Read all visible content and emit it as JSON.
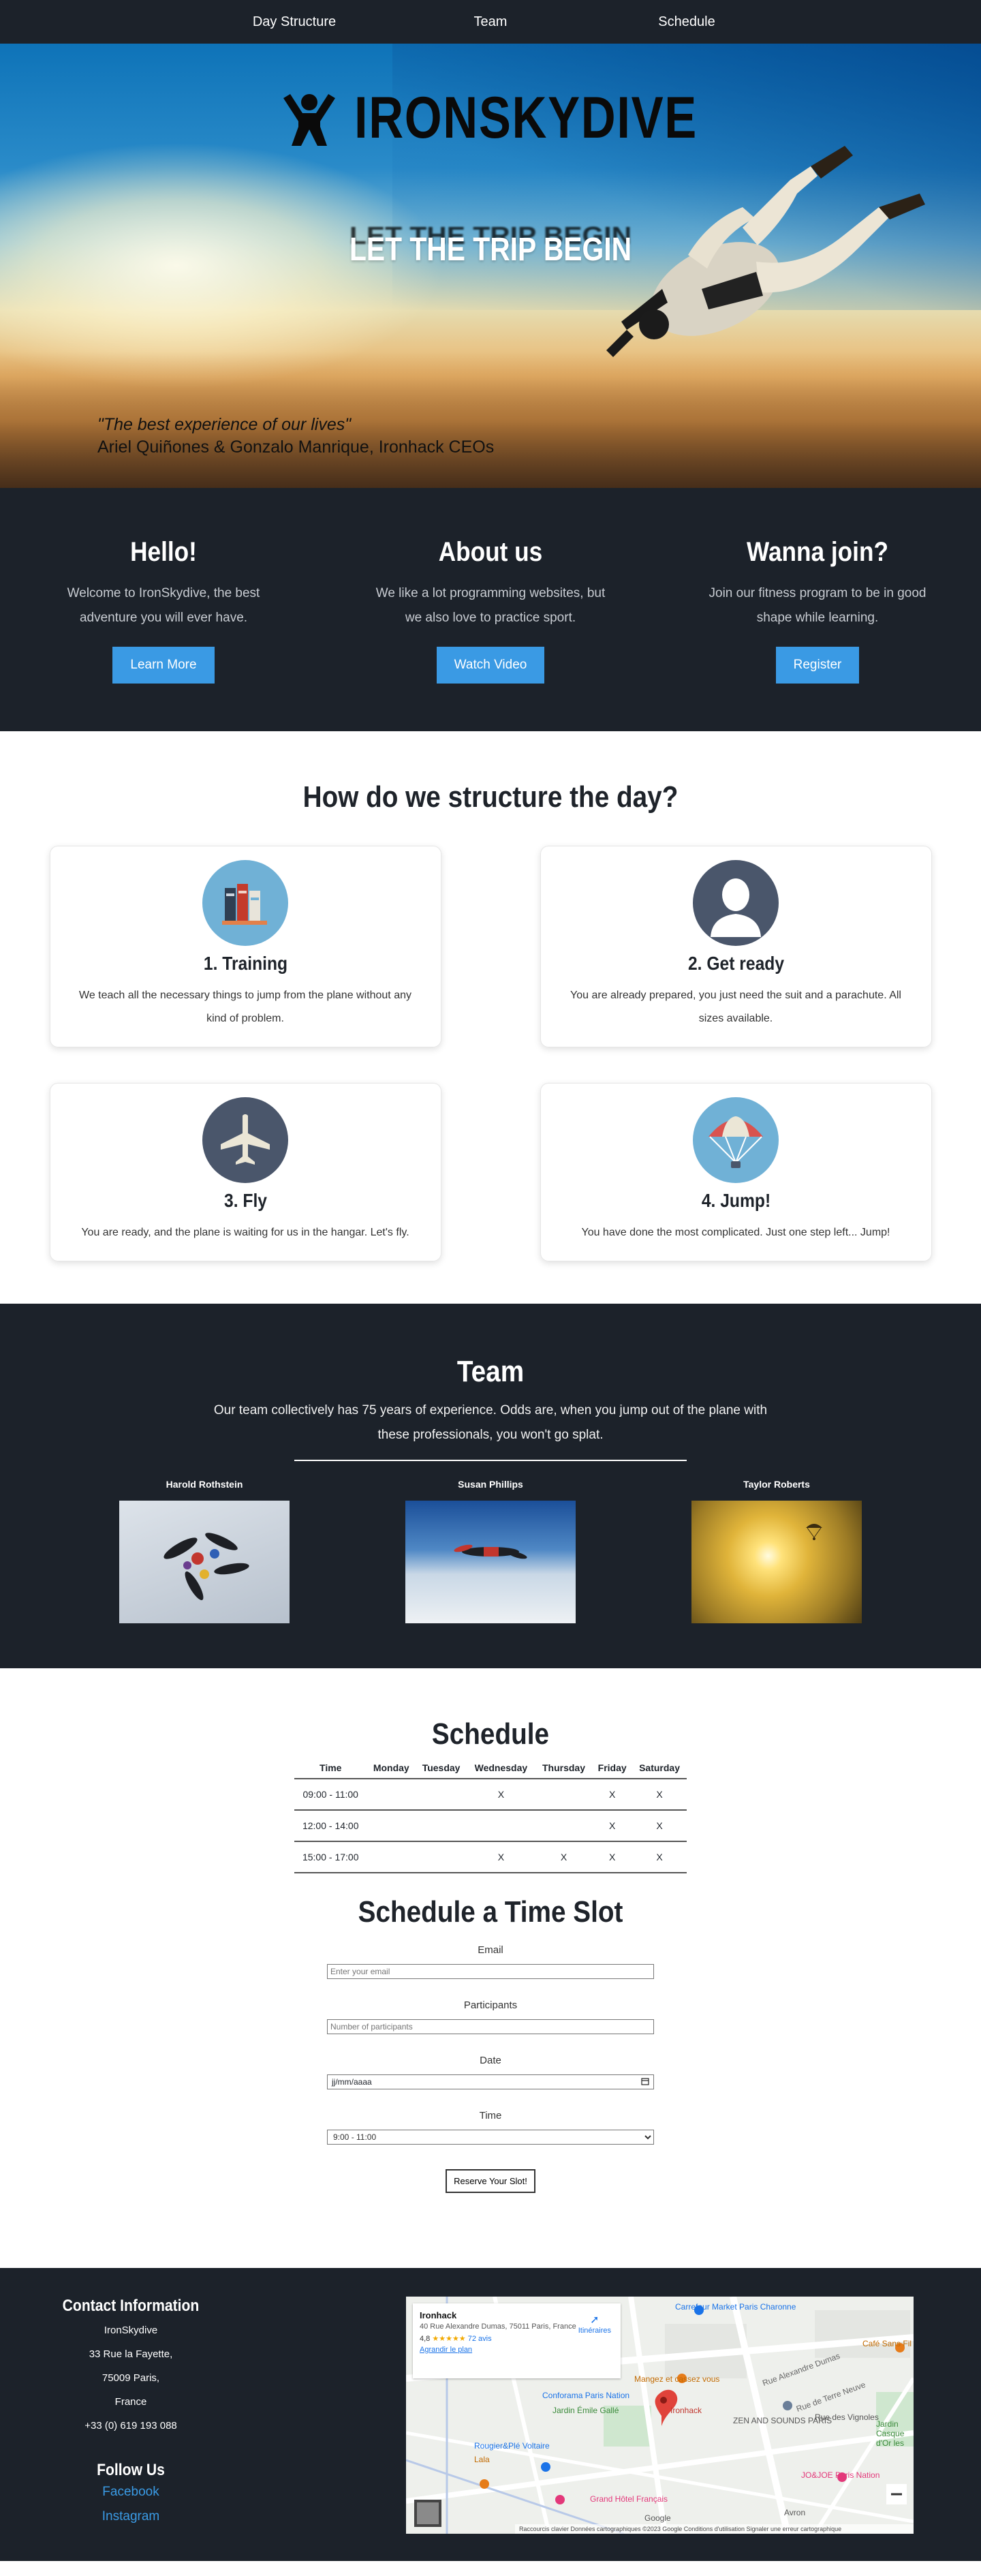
{
  "nav": {
    "items": [
      {
        "label": "Day Structure"
      },
      {
        "label": "Team"
      },
      {
        "label": "Schedule"
      }
    ]
  },
  "hero": {
    "brand": "IRONSKYDIVE",
    "logo_icon": "person-arms-up-icon",
    "tagline": "LET THE TRIP BEGIN",
    "quote": "\"The best experience of our lives\"",
    "quote_author": "Ariel Quiñones & Gonzalo Manrique, Ironhack CEOs"
  },
  "intro": [
    {
      "title": "Hello!",
      "text": "Welcome to IronSkydive, the best adventure you will ever have.",
      "button": "Learn More"
    },
    {
      "title": "About us",
      "text": "We like a lot programming websites, but we also love to practice sport.",
      "button": "Watch Video"
    },
    {
      "title": "Wanna join?",
      "text": "Join our fitness program to be in good shape while learning.",
      "button": "Register"
    }
  ],
  "day": {
    "title": "How do we structure the day?",
    "steps": [
      {
        "title": "1. Training",
        "text": "We teach all the necessary things to jump from the plane without any kind of problem.",
        "icon": "books-icon"
      },
      {
        "title": "2. Get ready",
        "text": "You are already prepared, you just need the suit and a parachute. All sizes available.",
        "icon": "person-silhouette-icon"
      },
      {
        "title": "3. Fly",
        "text": "You are ready, and the plane is waiting for us in the hangar. Let's fly.",
        "icon": "airplane-icon"
      },
      {
        "title": "4. Jump!",
        "text": "You have done the most complicated. Just one step left... Jump!",
        "icon": "parachute-icon"
      }
    ]
  },
  "team": {
    "title": "Team",
    "description": "Our team collectively has 75 years of experience. Odds are, when you jump out of the plane with these professionals, you won't go splat.",
    "members": [
      {
        "name": "Harold Rothstein"
      },
      {
        "name": "Susan Phillips"
      },
      {
        "name": "Taylor Roberts"
      }
    ]
  },
  "schedule": {
    "title": "Schedule",
    "headers": [
      "Time",
      "Monday",
      "Tuesday",
      "Wednesday",
      "Thursday",
      "Friday",
      "Saturday"
    ],
    "rows": [
      [
        "09:00 - 11:00",
        "",
        "",
        "X",
        "",
        "X",
        "X"
      ],
      [
        "12:00 - 14:00",
        "",
        "",
        "",
        "",
        "X",
        "X"
      ],
      [
        "15:00 - 17:00",
        "",
        "",
        "X",
        "X",
        "X",
        "X"
      ]
    ]
  },
  "booking": {
    "title": "Schedule a Time Slot",
    "email_label": "Email",
    "email_placeholder": "Enter your email",
    "participants_label": "Participants",
    "participants_placeholder": "Number of participants",
    "date_label": "Date",
    "date_value": "jj/mm/aaaa",
    "time_label": "Time",
    "time_value": "9:00 - 11:00",
    "submit": "Reserve Your Slot!"
  },
  "footer": {
    "contact_title": "Contact Information",
    "address": [
      "IronSkydive",
      "33 Rue la Fayette,",
      "75009 Paris,",
      "France",
      "+33 (0) 619 193 088"
    ],
    "follow_title": "Follow Us",
    "social": [
      "Facebook",
      "Instagram"
    ]
  },
  "map": {
    "place": "Ironhack",
    "address": "40 Rue Alexandre Dumas, 75011 Paris, France",
    "rating": "4,8",
    "stars": "★★★★★",
    "reviews": "72 avis",
    "enlarge": "Agrandir le plan",
    "directions": "Itinéraires",
    "labels": [
      "Carrefour Market Paris Charonne",
      "Café Sans Fil",
      "Conforama Paris Nation",
      "Mangez et cassez vous",
      "Jardin Émile Gallé",
      "Ironhack",
      "ZEN AND SOUNDS PARIS",
      "Rue des Vignoles",
      "Rougier&Plé Voltaire",
      "Lala",
      "JO&JOE Paris Nation",
      "Grand Hôtel Français",
      "Rue Alexandre Dumas",
      "Rue de Terre Neuve",
      "Avron",
      "Jardin Casque d'Or les"
    ],
    "footer": "Raccourcis clavier   Données cartographiques ©2023 Google   Conditions d'utilisation   Signaler une erreur cartographique",
    "google": "Google"
  }
}
